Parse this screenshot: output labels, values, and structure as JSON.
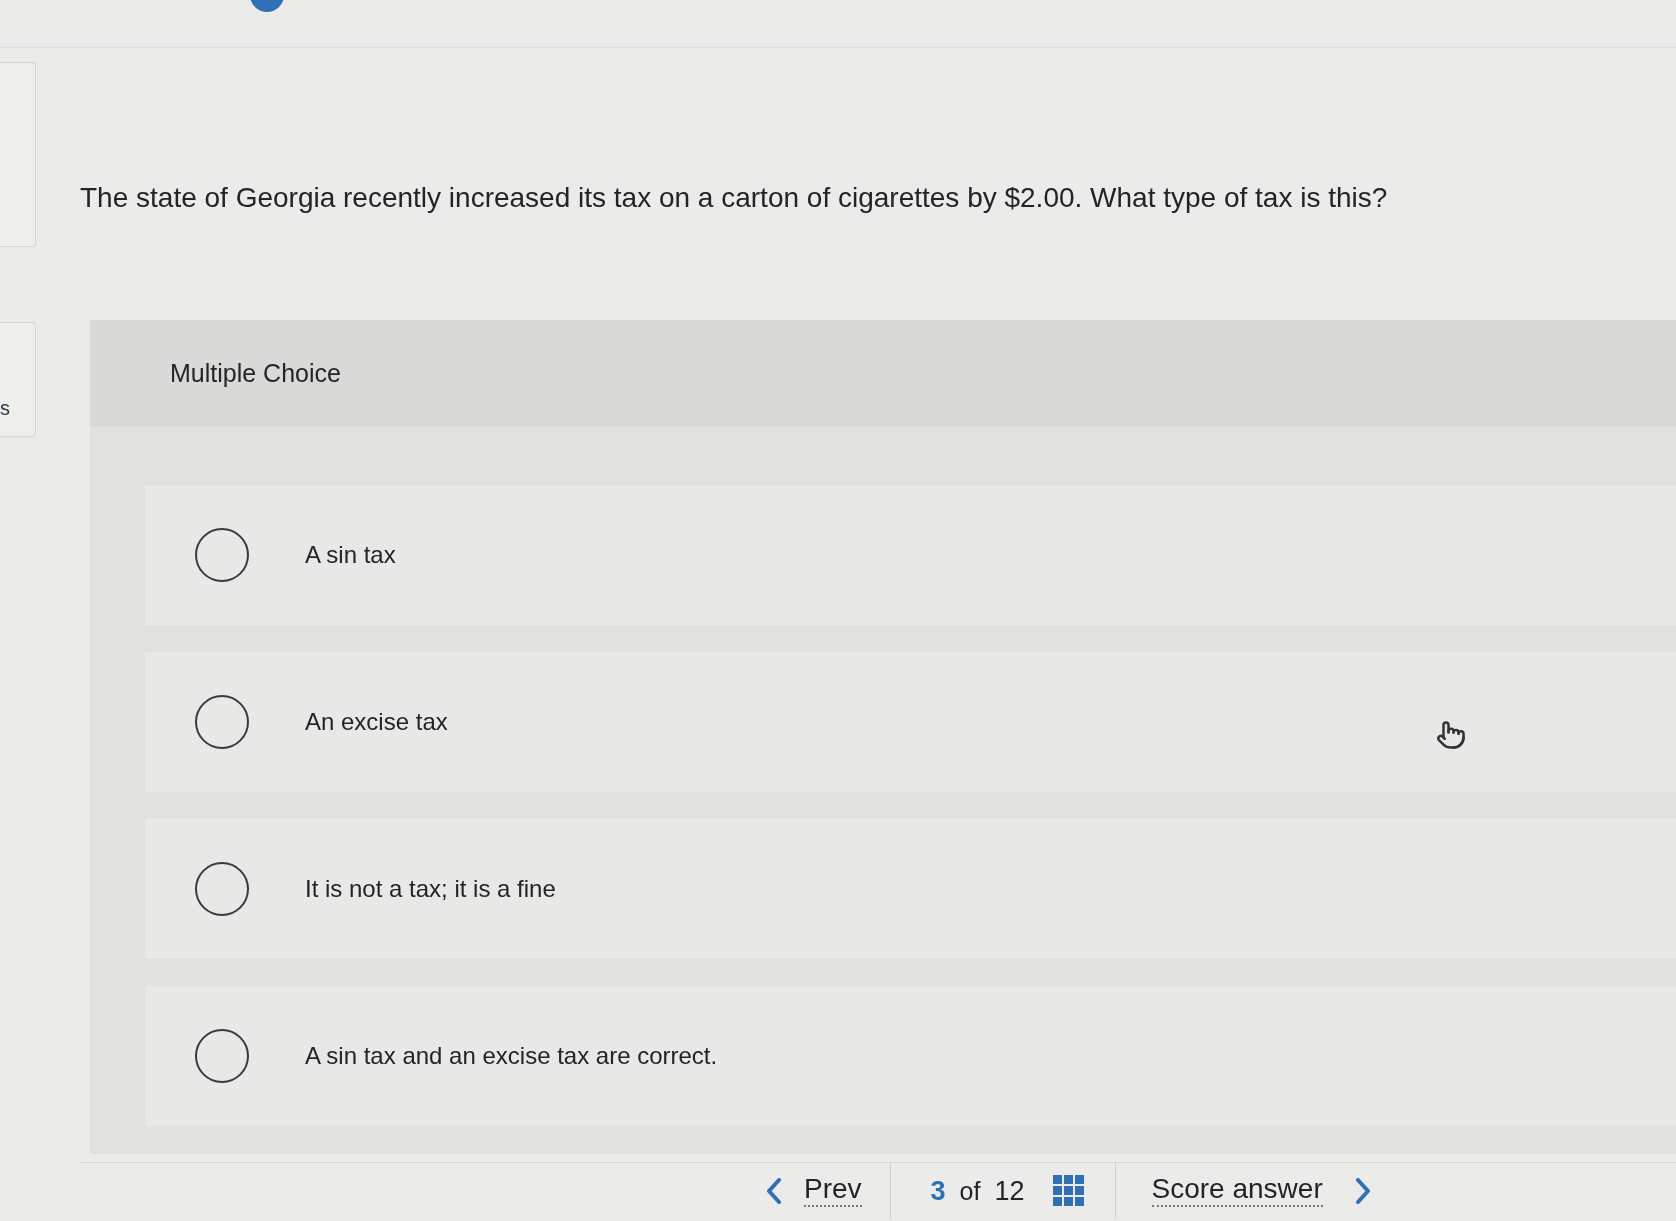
{
  "side_tab": {
    "label": "s"
  },
  "question": {
    "text": "The state of Georgia recently increased its tax on a carton of cigarettes by $2.00. What type of tax is this?"
  },
  "choice_panel": {
    "heading": "Multiple Choice",
    "options": [
      {
        "label": "A sin tax",
        "selected": false
      },
      {
        "label": "An excise tax",
        "selected": false
      },
      {
        "label": "It is not a tax; it is a fine",
        "selected": false
      },
      {
        "label": "A sin tax and an excise tax are correct.",
        "selected": false
      }
    ]
  },
  "nav": {
    "prev": "Prev",
    "current": "3",
    "of": "of",
    "total": "12",
    "score": "Score answer"
  }
}
